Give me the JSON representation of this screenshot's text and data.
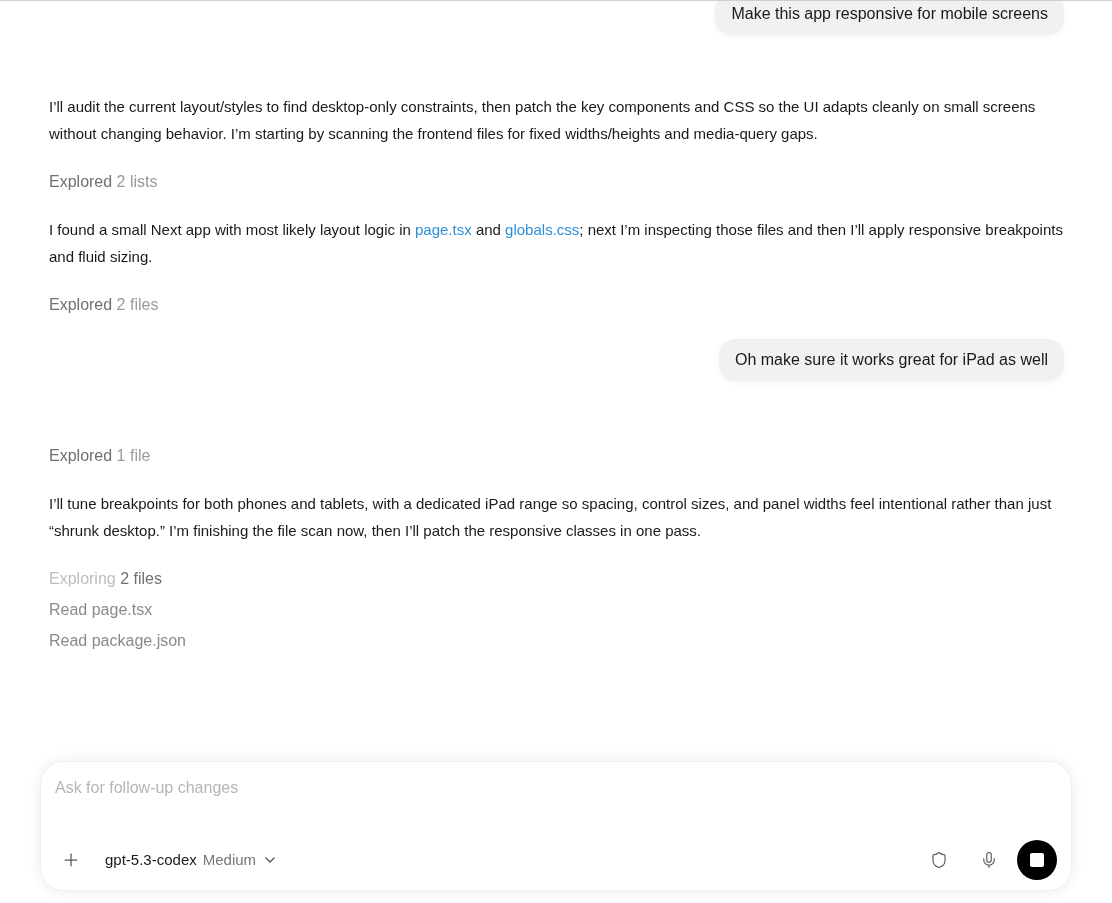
{
  "messages": [
    {
      "kind": "user",
      "text": "Make this app responsive for mobile screens"
    },
    {
      "kind": "paragraph",
      "parts": [
        {
          "text": "I’ll audit the current layout/styles to find desktop-only constraints, then patch the key components and CSS so the UI adapts cleanly on small screens without changing behavior. I’m starting by scanning the frontend files for fixed widths/heights and media-query gaps.",
          "link": false
        }
      ]
    },
    {
      "kind": "activity",
      "label": "Explored",
      "detail": "2 lists",
      "active": false
    },
    {
      "kind": "paragraph",
      "parts": [
        {
          "text": "I found a small Next app with most likely layout logic in ",
          "link": false
        },
        {
          "text": "page.tsx",
          "link": true
        },
        {
          "text": " and ",
          "link": false
        },
        {
          "text": "globals.css",
          "link": true
        },
        {
          "text": "; next I’m inspecting those files and then I’ll apply responsive breakpoints and fluid sizing.",
          "link": false
        }
      ]
    },
    {
      "kind": "activity",
      "label": "Explored",
      "detail": "2 files",
      "active": false
    },
    {
      "kind": "user",
      "text": "Oh make sure it works great for iPad as well"
    },
    {
      "kind": "activity",
      "label": "Explored",
      "detail": "1 file",
      "active": false
    },
    {
      "kind": "paragraph",
      "parts": [
        {
          "text": "I’ll tune breakpoints for both phones and tablets, with a dedicated iPad range so spacing, control sizes, and panel widths feel intentional rather than just “shrunk desktop.” I’m finishing the file scan now, then I’ll patch the responsive classes in one pass.",
          "link": false
        }
      ]
    },
    {
      "kind": "activity",
      "label": "Exploring",
      "detail": "2 files",
      "active": true
    },
    {
      "kind": "step",
      "text": "Read page.tsx"
    },
    {
      "kind": "step",
      "text": "Read package.json"
    }
  ],
  "composer": {
    "placeholder": "Ask for follow-up changes",
    "model": "gpt-5.3-codex",
    "effort": "Medium"
  }
}
